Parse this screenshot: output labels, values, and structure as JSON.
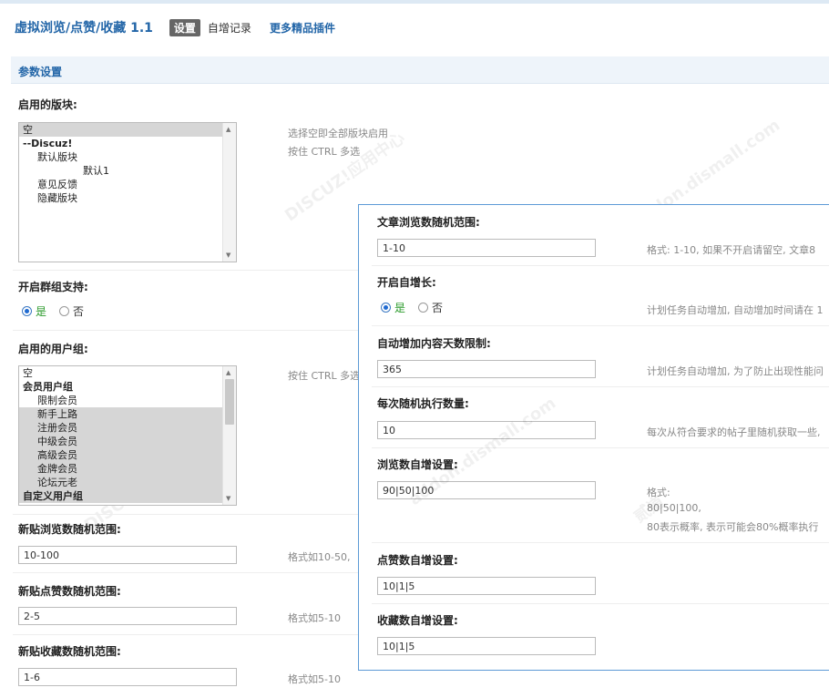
{
  "header": {
    "title": "虚拟浏览/点赞/收藏 1.1",
    "tabs": [
      {
        "label": "设置",
        "active": true
      },
      {
        "label": "自增记录"
      },
      {
        "label": "更多精品插件"
      }
    ]
  },
  "section": {
    "title": "参数设置"
  },
  "forums": {
    "label": "启用的版块:",
    "options": [
      "空",
      "--Discuz!",
      "默认版块",
      "默认1",
      "意见反馈",
      "隐藏版块"
    ],
    "hint1": "选择空即全部版块启用",
    "hint2": "按住 CTRL 多选"
  },
  "group_support": {
    "label": "开启群组支持:",
    "yes": "是",
    "no": "否",
    "value": "是"
  },
  "usergroups": {
    "label": "启用的用户组:",
    "options": [
      "空",
      "会员用户组",
      "限制会员",
      "新手上路",
      "注册会员",
      "中级会员",
      "高级会员",
      "金牌会员",
      "论坛元老",
      "自定义用户组"
    ],
    "hint": "按住 CTRL 多选"
  },
  "new_view": {
    "label": "新贴浏览数随机范围:",
    "value": "10-100",
    "hint": "格式如10-50,"
  },
  "new_like": {
    "label": "新贴点赞数随机范围:",
    "value": "2-5",
    "hint": "格式如5-10"
  },
  "new_fav": {
    "label": "新贴收藏数随机范围:",
    "value": "1-6",
    "hint": "格式如5-10"
  },
  "panel": {
    "article_view": {
      "label": "文章浏览数随机范围:",
      "value": "1-10",
      "hint": "格式: 1-10, 如果不开启请留空, 文章8"
    },
    "auto_inc": {
      "label": "开启自增长:",
      "yes": "是",
      "no": "否",
      "value": "是",
      "hint": "计划任务自动增加, 自动增加时间请在 1"
    },
    "days_limit": {
      "label": "自动增加内容天数限制:",
      "value": "365",
      "hint": "计划任务自动增加, 为了防止出现性能问"
    },
    "per_run": {
      "label": "每次随机执行数量:",
      "value": "10",
      "hint": "每次从符合要求的帖子里随机获取一些,"
    },
    "view_auto": {
      "label": "浏览数自增设置:",
      "value": "90|50|100",
      "hint1": "格式:",
      "hint2": "80|50|100,",
      "hint3": "80表示概率, 表示可能会80%概率执行"
    },
    "like_auto": {
      "label": "点赞数自增设置:",
      "value": "10|1|5"
    },
    "fav_auto": {
      "label": "收藏数自增设置:",
      "value": "10|1|5"
    }
  },
  "watermark": {
    "text1": "DISCUZ!应用中心",
    "text2": "贰道",
    "text3": "addon.dismall.com"
  }
}
